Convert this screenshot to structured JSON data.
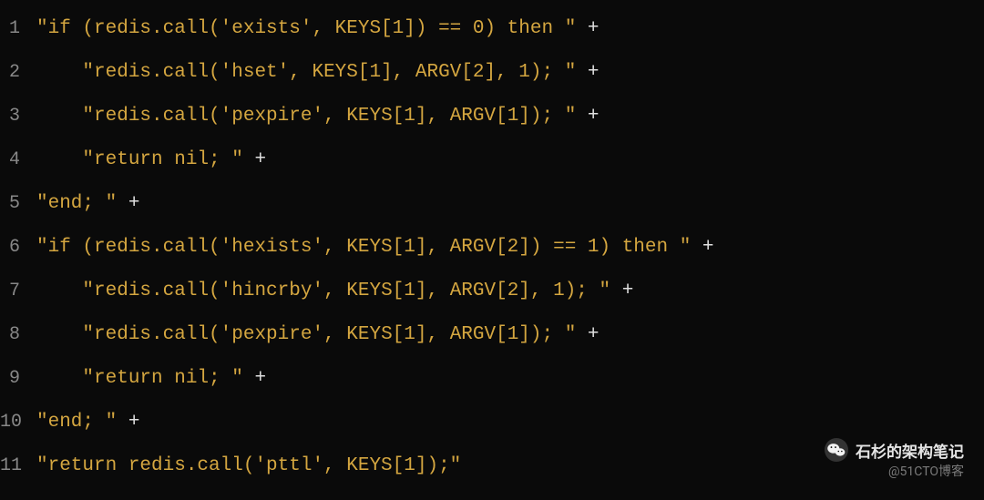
{
  "code": {
    "lines": [
      {
        "num": "1",
        "indent": "",
        "str": "\"if (redis.call('exists', KEYS[1]) == 0) then \"",
        "tail": " +"
      },
      {
        "num": "2",
        "indent": "    ",
        "str": "\"redis.call('hset', KEYS[1], ARGV[2], 1); \"",
        "tail": " +"
      },
      {
        "num": "3",
        "indent": "    ",
        "str": "\"redis.call('pexpire', KEYS[1], ARGV[1]); \"",
        "tail": " +"
      },
      {
        "num": "4",
        "indent": "    ",
        "str": "\"return nil; \"",
        "tail": " +"
      },
      {
        "num": "5",
        "indent": "",
        "str": "\"end; \"",
        "tail": " +"
      },
      {
        "num": "6",
        "indent": "",
        "str": "\"if (redis.call('hexists', KEYS[1], ARGV[2]) == 1) then \"",
        "tail": " +"
      },
      {
        "num": "7",
        "indent": "    ",
        "str": "\"redis.call('hincrby', KEYS[1], ARGV[2], 1); \"",
        "tail": " +"
      },
      {
        "num": "8",
        "indent": "    ",
        "str": "\"redis.call('pexpire', KEYS[1], ARGV[1]); \"",
        "tail": " +"
      },
      {
        "num": "9",
        "indent": "    ",
        "str": "\"return nil; \"",
        "tail": " +"
      },
      {
        "num": "10",
        "indent": "",
        "str": "\"end; \"",
        "tail": " +"
      },
      {
        "num": "11",
        "indent": "",
        "str": "\"return redis.call('pttl', KEYS[1]);\"",
        "tail": ""
      }
    ]
  },
  "watermark": {
    "title": "石杉的架构笔记",
    "sub": "@51CTO博客"
  }
}
